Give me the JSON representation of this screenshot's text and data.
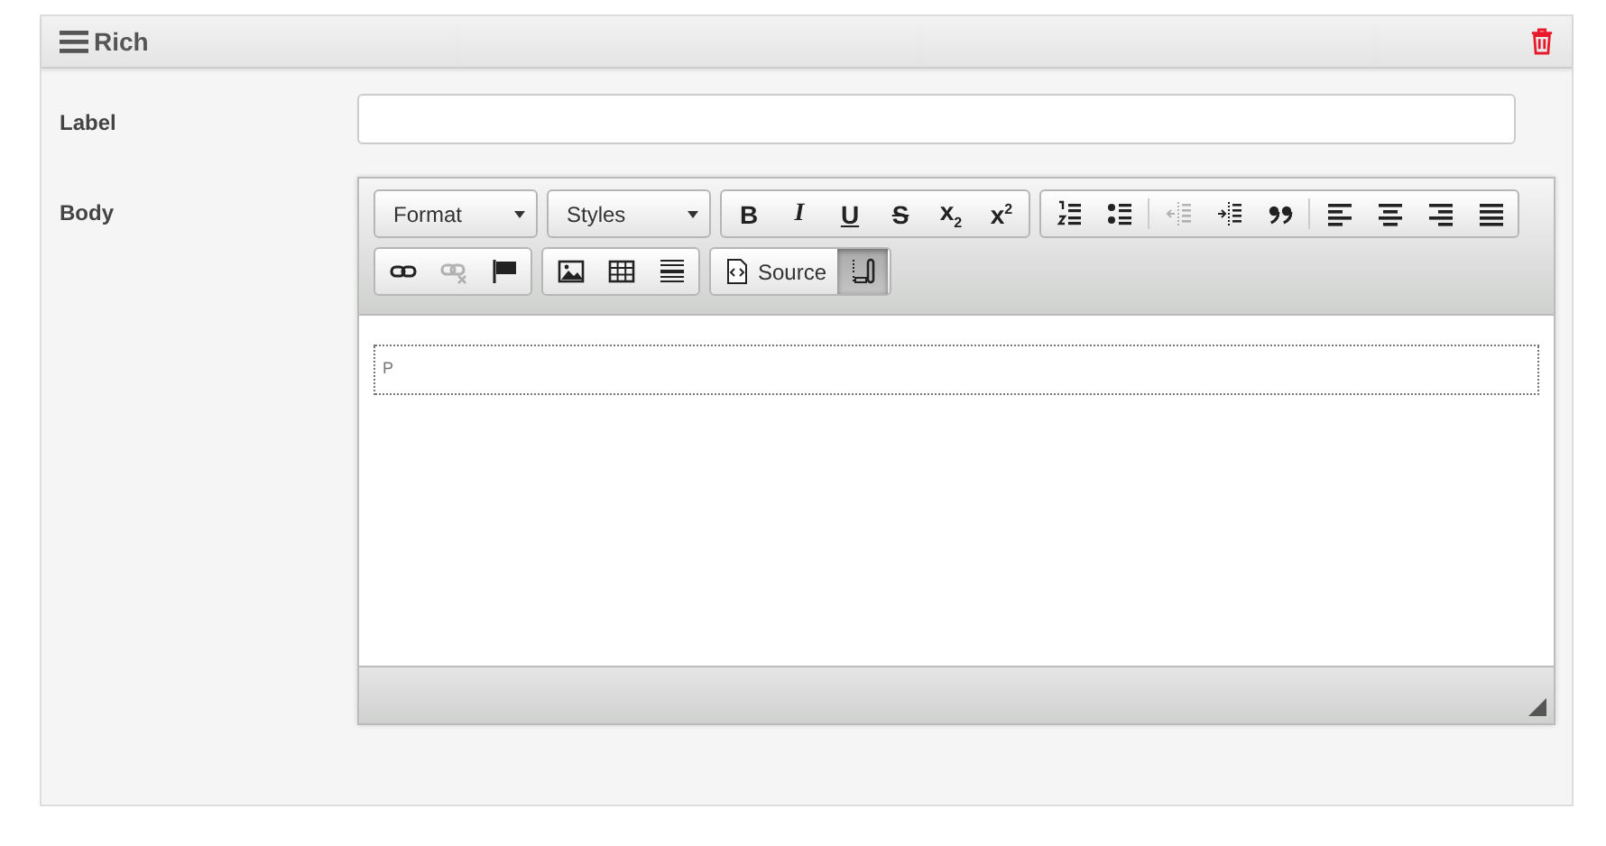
{
  "panel": {
    "title": "Rich"
  },
  "fields": [
    {
      "label": "Label",
      "kind": "text"
    },
    {
      "label": "Body",
      "kind": "editor"
    }
  ],
  "editor": {
    "toolbar_rows": [
      [
        {
          "kind": "combo",
          "items": [
            {
              "label": "Format"
            }
          ]
        },
        {
          "kind": "combo",
          "items": [
            {
              "label": "Styles"
            }
          ]
        },
        {
          "kind": "group",
          "items": [
            {
              "kind": "bold",
              "label": "B",
              "disabled": false,
              "on": false
            },
            {
              "kind": "italic",
              "label": "I",
              "disabled": false,
              "on": false
            },
            {
              "kind": "underline",
              "label": "U",
              "disabled": false,
              "on": false
            },
            {
              "kind": "strike",
              "label": "S",
              "disabled": false,
              "on": false
            },
            {
              "kind": "subscript",
              "label": "x$_{2}$",
              "disabled": false,
              "on": false
            },
            {
              "kind": "superscript",
              "label": "x$^{2}$",
              "disabled": false,
              "on": false
            }
          ]
        },
        {
          "kind": "group",
          "items": [
            {
              "kind": "numbered",
              "disabled": false,
              "on": false
            },
            {
              "kind": "bulleted",
              "disabled": false,
              "on": false
            },
            {
              "kind": "separator"
            },
            {
              "kind": "outdent",
              "disabled": true,
              "on": false
            },
            {
              "kind": "indent",
              "disabled": false,
              "on": false
            },
            {
              "kind": "quote",
              "disabled": false,
              "on": false
            },
            {
              "kind": "separator"
            },
            {
              "kind": "left",
              "disabled": false,
              "on": false
            },
            {
              "kind": "center",
              "disabled": false,
              "on": false
            },
            {
              "kind": "right",
              "disabled": false,
              "on": false
            },
            {
              "kind": "justify",
              "disabled": false,
              "on": false
            }
          ]
        }
      ],
      [
        {
          "kind": "group",
          "items": [
            {
              "kind": "link",
              "disabled": false,
              "on": false
            },
            {
              "kind": "unlink",
              "disabled": true,
              "on": false
            },
            {
              "kind": "anchor",
              "disabled": false,
              "on": false
            }
          ]
        },
        {
          "kind": "group",
          "items": [
            {
              "kind": "image",
              "disabled": false,
              "on": false
            },
            {
              "kind": "table",
              "disabled": false,
              "on": false
            },
            {
              "kind": "rule",
              "disabled": false,
              "on": false
            }
          ]
        },
        {
          "kind": "group",
          "items": [
            {
              "kind": "source",
              "label": "Source",
              "disabled": false,
              "on": false
            },
            {
              "kind": "blocks",
              "disabled": false,
              "on": true
            }
          ]
        }
      ]
    ],
    "block_tag": "P"
  }
}
